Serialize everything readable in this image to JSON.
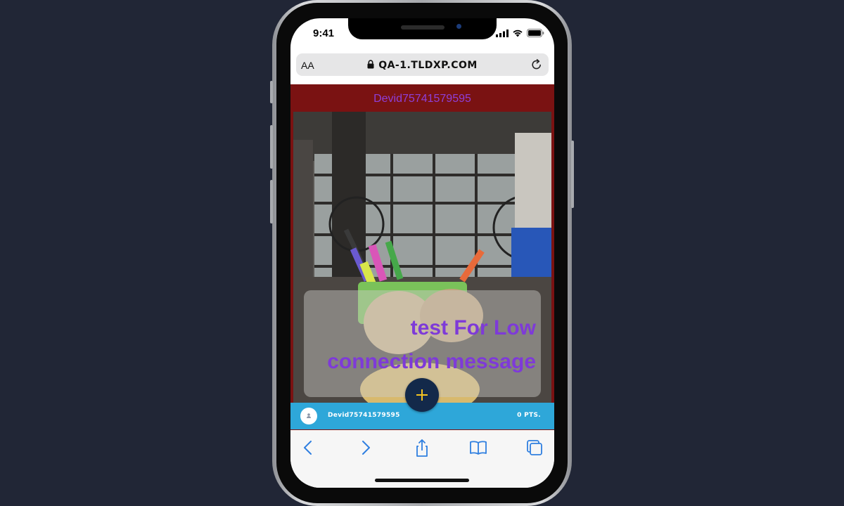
{
  "status_bar": {
    "time": "9:41"
  },
  "browser": {
    "text_size_label": "AA",
    "url": "QA-1.TLDXP.COM"
  },
  "page": {
    "header_username": "Devid75741579595",
    "message": "test For Low connection message",
    "user_bar": {
      "username": "Devid75741579595",
      "points": "0 PTS."
    }
  },
  "icons": {
    "add": "plus-icon",
    "reload": "reload-icon",
    "lock": "lock-icon",
    "back": "chevron-left-icon",
    "forward": "chevron-right-icon",
    "share": "share-icon",
    "bookmarks": "book-icon",
    "tabs": "tabs-icon"
  },
  "colors": {
    "page_background": "#7a1212",
    "header_text": "#8e3fd8",
    "message_text": "#7e3ad8",
    "user_bar": "#2ea7d9",
    "plus_button": "#13294a",
    "plus_glyph": "#f5c422",
    "toolbar_icons": "#2f7fe0"
  }
}
